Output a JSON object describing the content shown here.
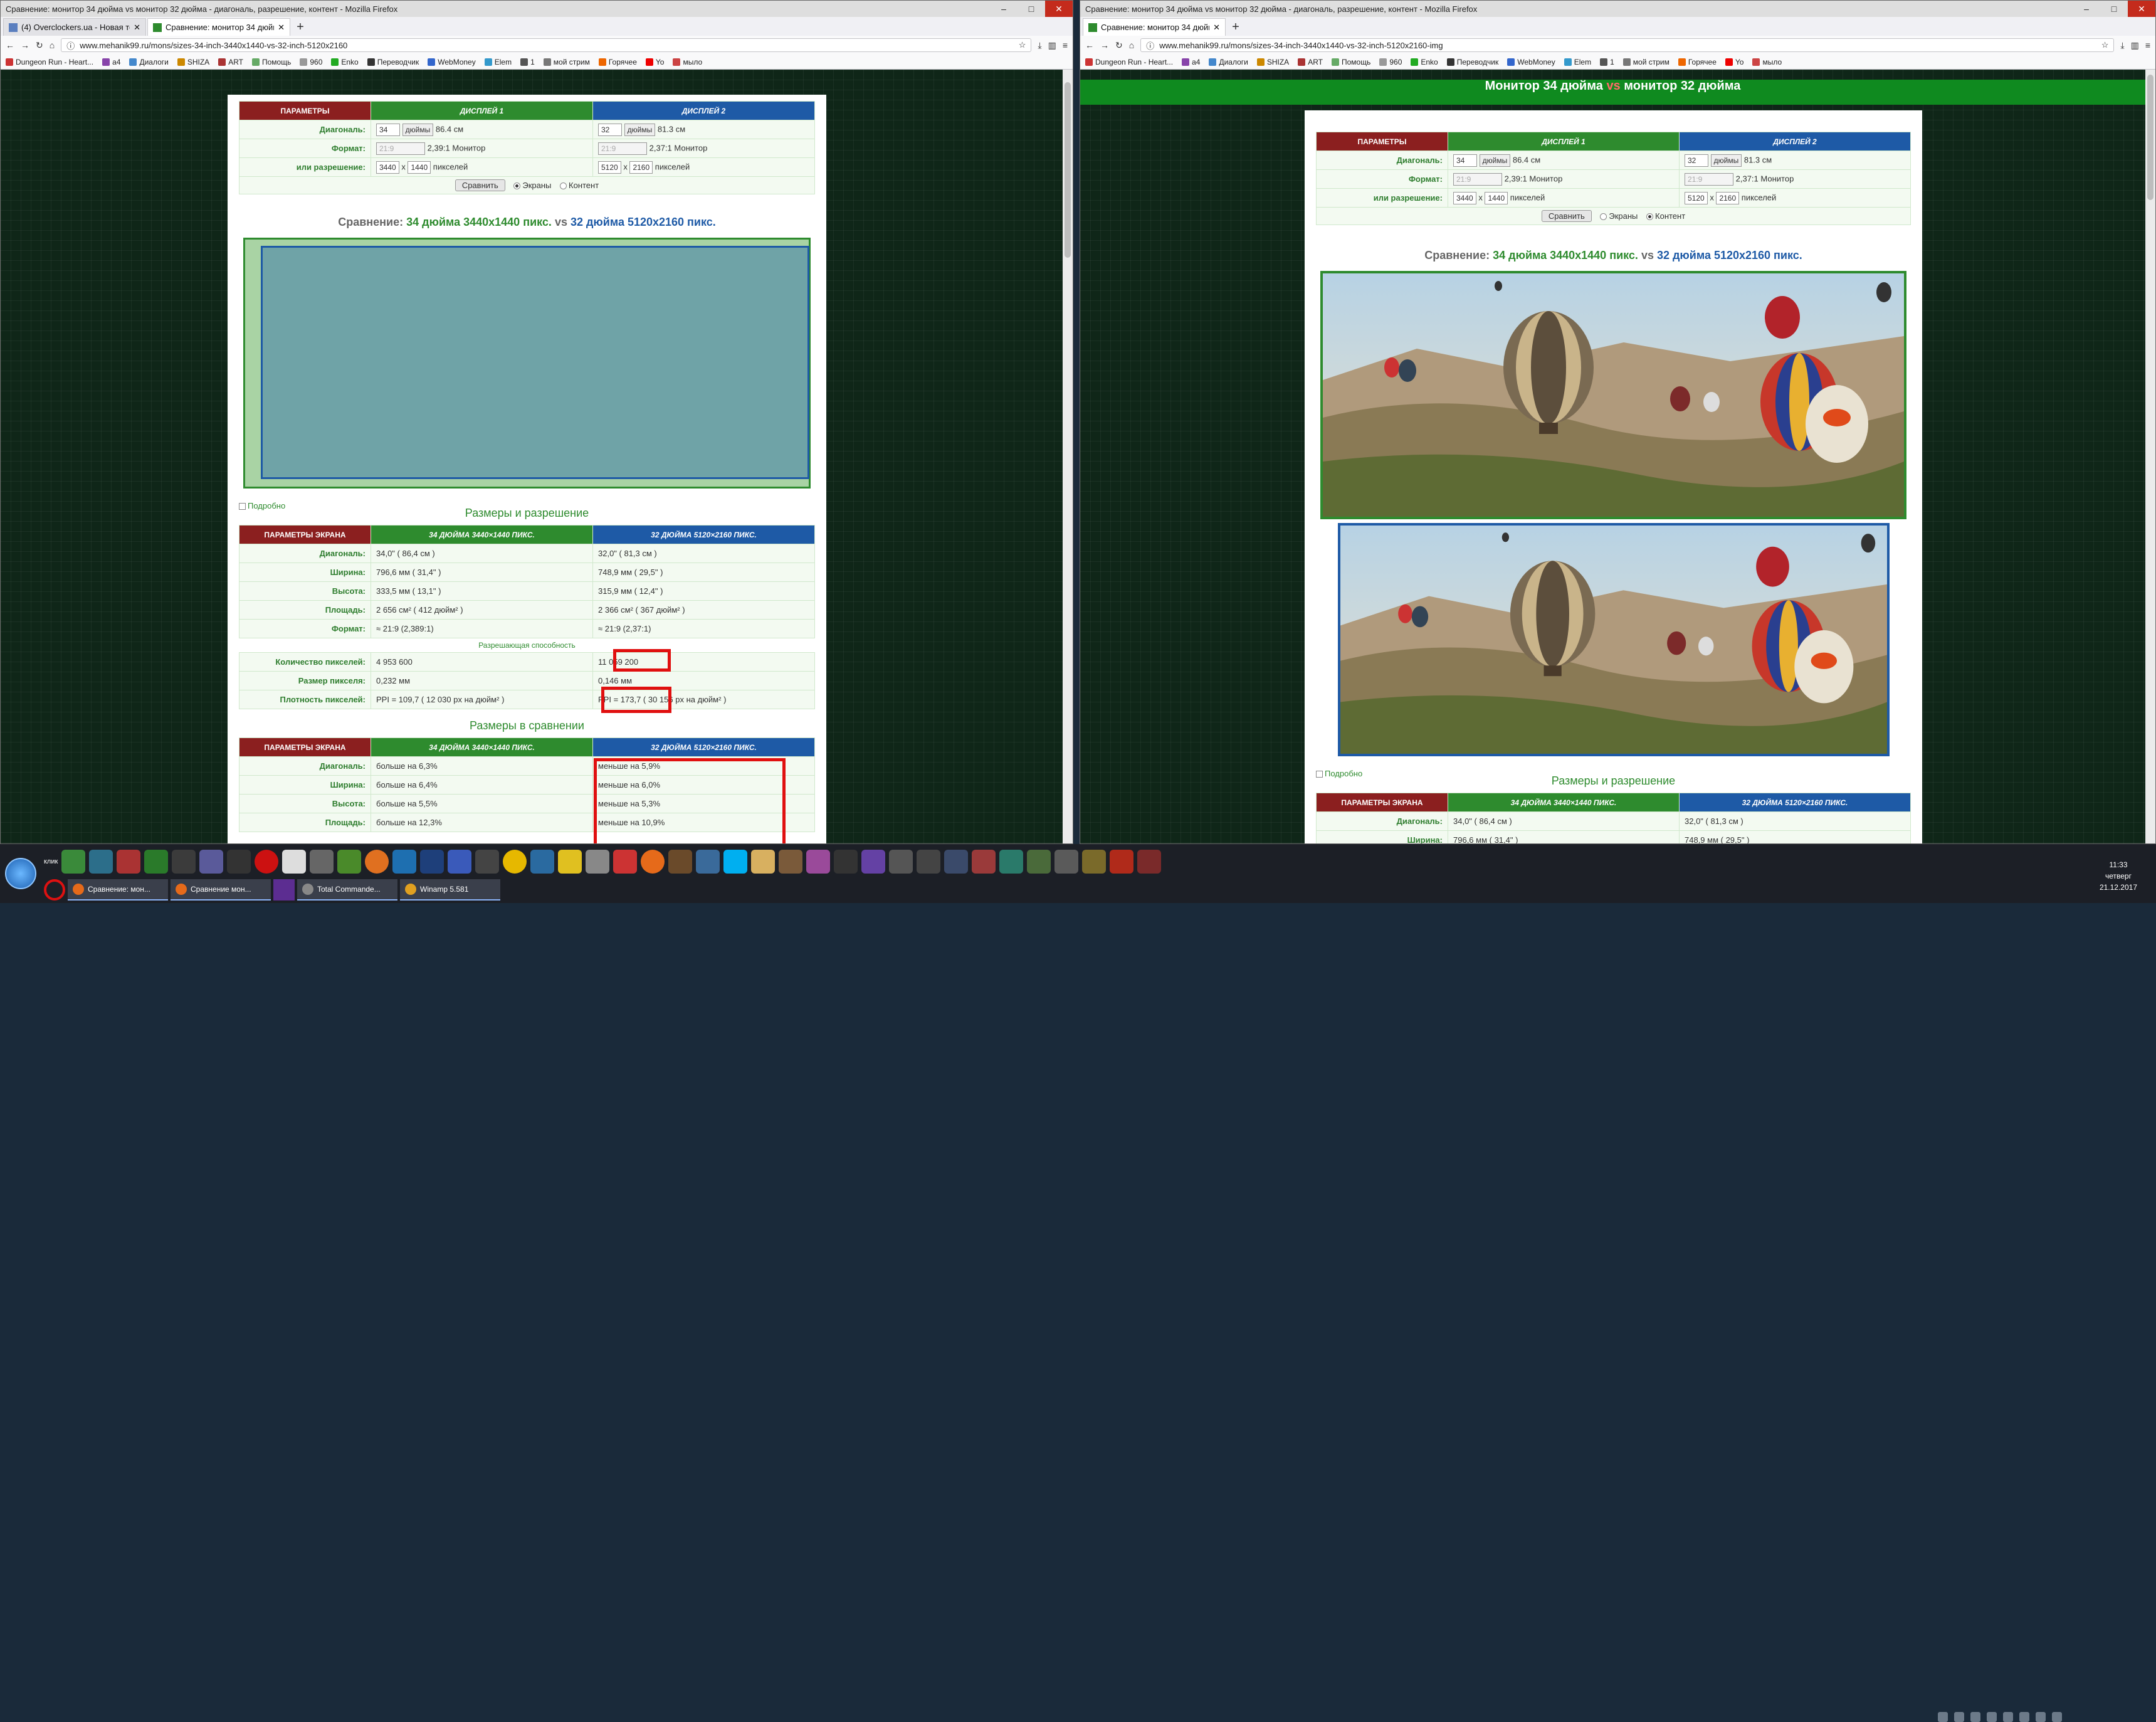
{
  "left": {
    "window_title": "Сравнение: монитор 34 дюйма vs монитор 32 дюйма - диагональ, разрешение, контент - Mozilla Firefox",
    "tabs": [
      {
        "label": "(4) Overclockers.ua - Новая тем"
      },
      {
        "label": "Сравнение: монитор 34 дюйм"
      }
    ],
    "url": "www.mehanik99.ru/mons/sizes-34-inch-3440x1440-vs-32-inch-5120x2160"
  },
  "right": {
    "window_title": "Сравнение: монитор 34 дюйма vs монитор 32 дюйма - диагональ, разрешение, контент - Mozilla Firefox",
    "tabs": [
      {
        "label": "Сравнение: монитор 34 дюйм"
      }
    ],
    "url": "www.mehanik99.ru/mons/sizes-34-inch-3440x1440-vs-32-inch-5120x2160-img",
    "banner": {
      "pre": "Монитор 34 дюйма",
      "vs": "vs",
      "post": "монитор 32 дюйма"
    }
  },
  "window_controls": {
    "min": "–",
    "max": "□",
    "close": "✕"
  },
  "bookmarks": [
    "Dungeon Run - Heart...",
    "a4",
    "Диалоги",
    "SHIZA",
    "ART",
    "Помощь",
    "960",
    "Enko",
    "Переводчик",
    "WebMoney",
    "Elem",
    "1",
    "мой стрим",
    "Горячее",
    "Yo",
    "мыло"
  ],
  "params": {
    "header": {
      "params": "ПАРАМЕТРЫ",
      "d1": "ДИСПЛЕЙ 1",
      "d2": "ДИСПЛЕЙ 2"
    },
    "diag_label": "Диагональ:",
    "format_label": "Формат:",
    "res_label": "или разрешение:",
    "d1": {
      "diag": "34",
      "unit": "дюймы",
      "cm": "86.4 см",
      "format": "21:9",
      "format_text": "2,39:1 Монитор",
      "w": "3440",
      "h": "1440",
      "px": "пикселей"
    },
    "d2": {
      "diag": "32",
      "unit": "дюймы",
      "cm": "81.3 см",
      "format": "21:9",
      "format_text": "2,37:1 Монитор",
      "w": "5120",
      "h": "2160",
      "px": "пикселей"
    },
    "x": "x",
    "compare_btn": "Сравнить",
    "opt_screens": "Экраны",
    "opt_content": "Контент"
  },
  "compare_title": {
    "pre": "Сравнение:",
    "d1": "34 дюйма 3440x1440 пикс.",
    "vs": "vs",
    "d2": "32 дюйма 5120x2160 пикс."
  },
  "detail_check": "Подробно",
  "sizes_title": "Размеры и разрешение",
  "screen_table": {
    "header": {
      "params": "ПАРАМЕТРЫ ЭКРАНА",
      "d1": "34 ДЮЙМА 3440×1440 ПИКС.",
      "d2": "32 ДЮЙМА 5120×2160 ПИКС."
    },
    "rows": [
      {
        "label": "Диагональ:",
        "v1": "34,0\" ( 86,4 см )",
        "v2": "32,0\" ( 81,3 см )"
      },
      {
        "label": "Ширина:",
        "v1": "796,6 мм ( 31,4\" )",
        "v2": "748,9 мм ( 29,5\" )"
      },
      {
        "label": "Высота:",
        "v1": "333,5 мм ( 13,1\" )",
        "v2": "315,9 мм ( 12,4\" )"
      },
      {
        "label": "Площадь:",
        "v1": "2 656 см² ( 412 дюйм² )",
        "v2": "2 366 см² ( 367 дюйм² )"
      },
      {
        "label": "Формат:",
        "v1": "≈ 21:9 (2,389:1)",
        "v2": "≈ 21:9 (2,37:1)"
      }
    ]
  },
  "resolution_caption": "Разрешающая способность",
  "res_table": {
    "rows": [
      {
        "label": "Количество пикселей:",
        "v1": "4 953 600",
        "v2": "11 059 200"
      },
      {
        "label": "Размер пикселя:",
        "v1": "0,232 мм",
        "v2": "0,146 мм"
      },
      {
        "label": "Плотность пикселей:",
        "v1": "PPI = 109,7 ( 12 030 px на дюйм² )",
        "v2": "PPI = 173,7 ( 30 156 px на дюйм² )"
      }
    ]
  },
  "compare_section_title": "Размеры в сравнении",
  "cmp_table": {
    "rows": [
      {
        "label": "Диагональ:",
        "v1": "больше на 6,3%",
        "v2": "меньше на 5,9%"
      },
      {
        "label": "Ширина:",
        "v1": "больше на 6,4%",
        "v2": "меньше на 6,0%"
      },
      {
        "label": "Высота:",
        "v1": "больше на 5,5%",
        "v2": "меньше на 5,3%"
      },
      {
        "label": "Площадь:",
        "v1": "больше на 12,3%",
        "v2": "меньше на 10,9%"
      }
    ]
  },
  "taskbar": {
    "tasks": [
      {
        "label": "Сравнение: мон..."
      },
      {
        "label": "Сравнение мон..."
      },
      {
        "label": "Total Commande..."
      },
      {
        "label": "Winamp 5.581"
      }
    ],
    "quick_label": "клик",
    "clock": {
      "time": "11:33",
      "day": "четверг",
      "date": "21.12.2017"
    }
  },
  "colors": {
    "red": "#8b1f1f",
    "green": "#2e8b2e",
    "blue": "#1e5aa6",
    "highlight": "#e01010"
  }
}
